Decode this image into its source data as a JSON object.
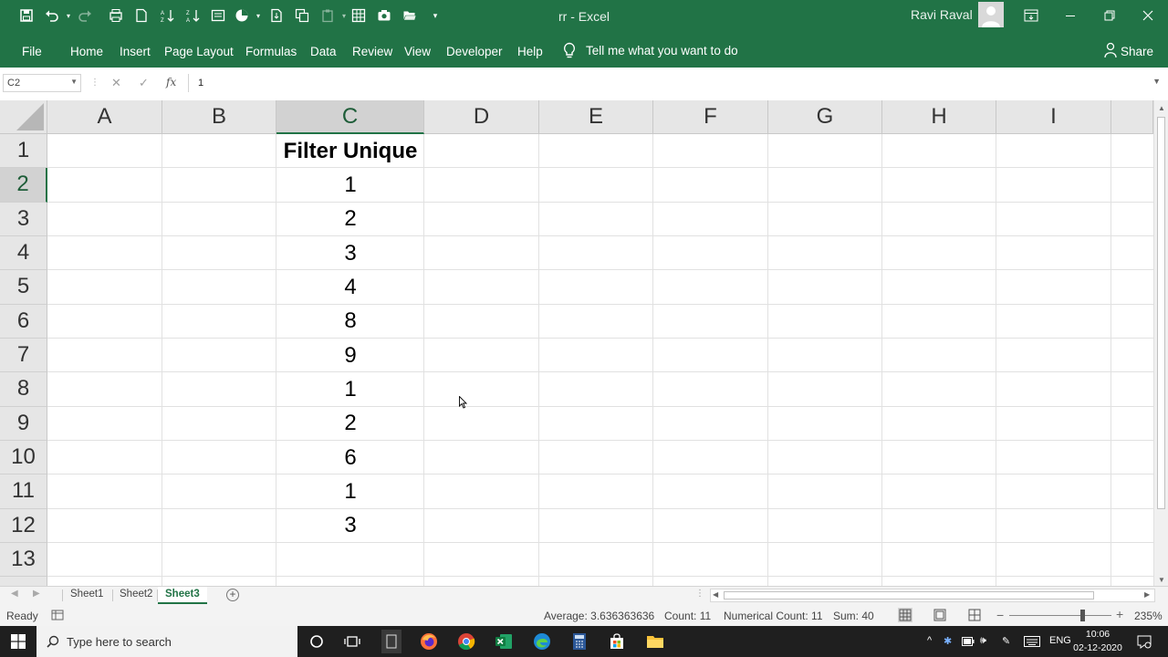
{
  "window": {
    "doc_title": "rr  -  Excel",
    "user_name": "Ravi Raval"
  },
  "ribbon": {
    "tabs": [
      "File",
      "Home",
      "Insert",
      "Page Layout",
      "Formulas",
      "Data",
      "Review",
      "View",
      "Developer",
      "Help"
    ],
    "tell_me": "Tell me what you want to do",
    "share": "Share"
  },
  "formula_bar": {
    "name_box": "C2",
    "fx_label": "fx",
    "value": "1"
  },
  "grid": {
    "columns": [
      "A",
      "B",
      "C",
      "D",
      "E",
      "F",
      "G",
      "H",
      "I"
    ],
    "selected_column": "C",
    "rows": [
      "1",
      "2",
      "3",
      "4",
      "5",
      "6",
      "7",
      "8",
      "9",
      "10",
      "11",
      "12",
      "13"
    ],
    "selected_row": "2",
    "column_c": [
      "Filter Unique",
      "1",
      "2",
      "3",
      "4",
      "8",
      "9",
      "1",
      "2",
      "6",
      "1",
      "3",
      ""
    ]
  },
  "sheets": {
    "tabs": [
      "Sheet1",
      "Sheet2",
      "Sheet3"
    ],
    "active": "Sheet3"
  },
  "status": {
    "ready": "Ready",
    "average": "Average: 3.636363636",
    "count": "Count: 11",
    "numerical_count": "Numerical Count: 11",
    "sum": "Sum: 40",
    "zoom": "235%"
  },
  "taskbar": {
    "search_placeholder": "Type here to search",
    "lang": "ENG",
    "time": "10:06",
    "date": "02-12-2020"
  },
  "colors": {
    "excel_green": "#217346",
    "header_gray": "#e6e6e6",
    "taskbar": "#1f1f1f"
  }
}
